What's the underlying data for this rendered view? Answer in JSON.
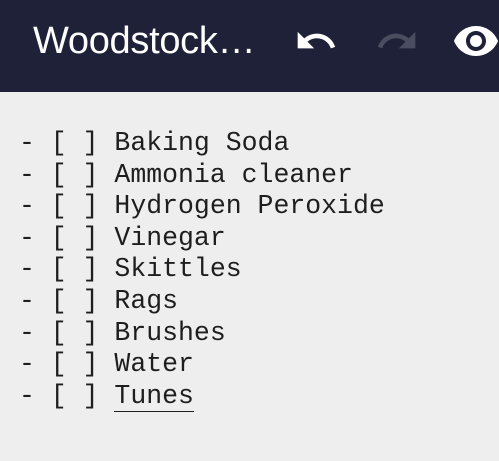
{
  "toolbar": {
    "title": "Woodstock…",
    "background": "#1f2139",
    "actions": [
      {
        "name": "undo",
        "icon": "undo-icon",
        "enabled": true
      },
      {
        "name": "redo",
        "icon": "redo-icon",
        "enabled": false
      },
      {
        "name": "preview",
        "icon": "eye-icon",
        "enabled": true
      }
    ]
  },
  "editor": {
    "prefix": "- [ ] ",
    "lines": [
      "Baking Soda",
      "Ammonia cleaner",
      "Hydrogen Peroxide",
      "Vinegar",
      "Skittles",
      "Rags",
      "Brushes",
      "Water",
      "Tunes"
    ],
    "current_line_index": 8
  }
}
